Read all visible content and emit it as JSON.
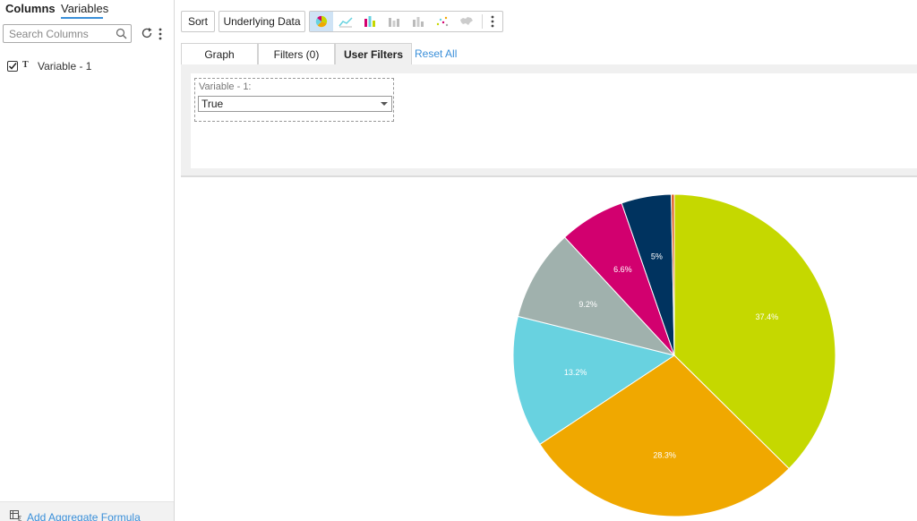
{
  "left_panel": {
    "tabs": [
      {
        "label": "Columns",
        "active": false
      },
      {
        "label": "Variables",
        "active": true
      }
    ],
    "search": {
      "placeholder": "Search Columns",
      "value": ""
    },
    "variables": [
      {
        "label": "Variable - 1",
        "type_icon": "T",
        "checked": true
      }
    ],
    "footer_link": "Add Aggregate Formula"
  },
  "toolbar": {
    "sort_label": "Sort",
    "underlying_data_label": "Underlying Data",
    "chart_types": [
      {
        "icon": "pie-chart-icon",
        "active": true
      },
      {
        "icon": "line-chart-icon",
        "active": false
      },
      {
        "icon": "bar-chart-icon",
        "active": false
      },
      {
        "icon": "column-chart-icon",
        "active": false
      },
      {
        "icon": "stacked-chart-icon",
        "active": false
      },
      {
        "icon": "scatter-chart-icon",
        "active": false
      },
      {
        "icon": "map-chart-icon",
        "active": false
      }
    ]
  },
  "tabs": [
    {
      "label": "Graph",
      "active": false
    },
    {
      "label": "Filters (0)",
      "active": false
    },
    {
      "label": "User Filters",
      "active": true
    }
  ],
  "reset_all_label": "Reset All",
  "user_filter": {
    "label": "Variable - 1:",
    "selected": "True"
  },
  "colors": {
    "accent": "#3a8fd9",
    "active_chart_button": "#cfe3f5"
  },
  "chart_data": {
    "type": "pie",
    "start_angle_deg": 0,
    "direction": "clockwise",
    "slices": [
      {
        "value": 37.4,
        "label": "37.4%",
        "color": "#c5d800"
      },
      {
        "value": 28.3,
        "label": "28.3%",
        "color": "#f0a800"
      },
      {
        "value": 13.2,
        "label": "13.2%",
        "color": "#68d2e0"
      },
      {
        "value": 9.2,
        "label": "9.2%",
        "color": "#a0b1ad"
      },
      {
        "value": 6.6,
        "label": "6.6%",
        "color": "#d2006f"
      },
      {
        "value": 5.0,
        "label": "5%",
        "color": "#00335f"
      },
      {
        "value": 0.3,
        "label": "",
        "color": "#e05a1a"
      }
    ]
  }
}
